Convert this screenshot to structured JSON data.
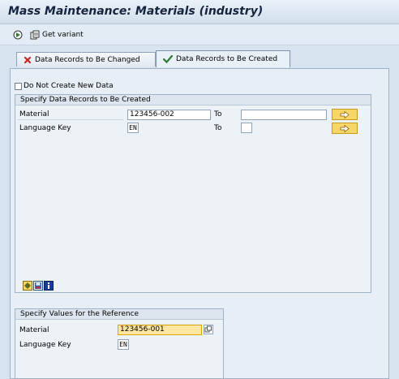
{
  "window": {
    "title": "Mass Maintenance: Materials (industry)"
  },
  "toolbar": {
    "get_variant_label": "Get variant"
  },
  "tabs": [
    {
      "label": "Data Records to Be Changed",
      "icon": "red-x-icon",
      "active": false
    },
    {
      "label": "Data Records to Be Created",
      "icon": "green-check-icon",
      "active": true
    }
  ],
  "options": {
    "do_not_create_label": "Do Not Create New Data",
    "do_not_create_checked": false
  },
  "created_group": {
    "title": "Specify Data Records to Be Created",
    "rows": [
      {
        "label": "Material",
        "from": "123456-002",
        "to_label": "To",
        "to": ""
      },
      {
        "label": "Language Key",
        "from": "EN",
        "to_label": "To",
        "to": ""
      }
    ]
  },
  "reference_group": {
    "title": "Specify Values for the Reference",
    "rows": [
      {
        "label": "Material",
        "value": "123456-001"
      },
      {
        "label": "Language Key",
        "value": "EN"
      }
    ]
  },
  "colors": {
    "accent_yellow": "#f7d668",
    "focus_field": "#fde7a0",
    "title_text": "#15253f"
  }
}
